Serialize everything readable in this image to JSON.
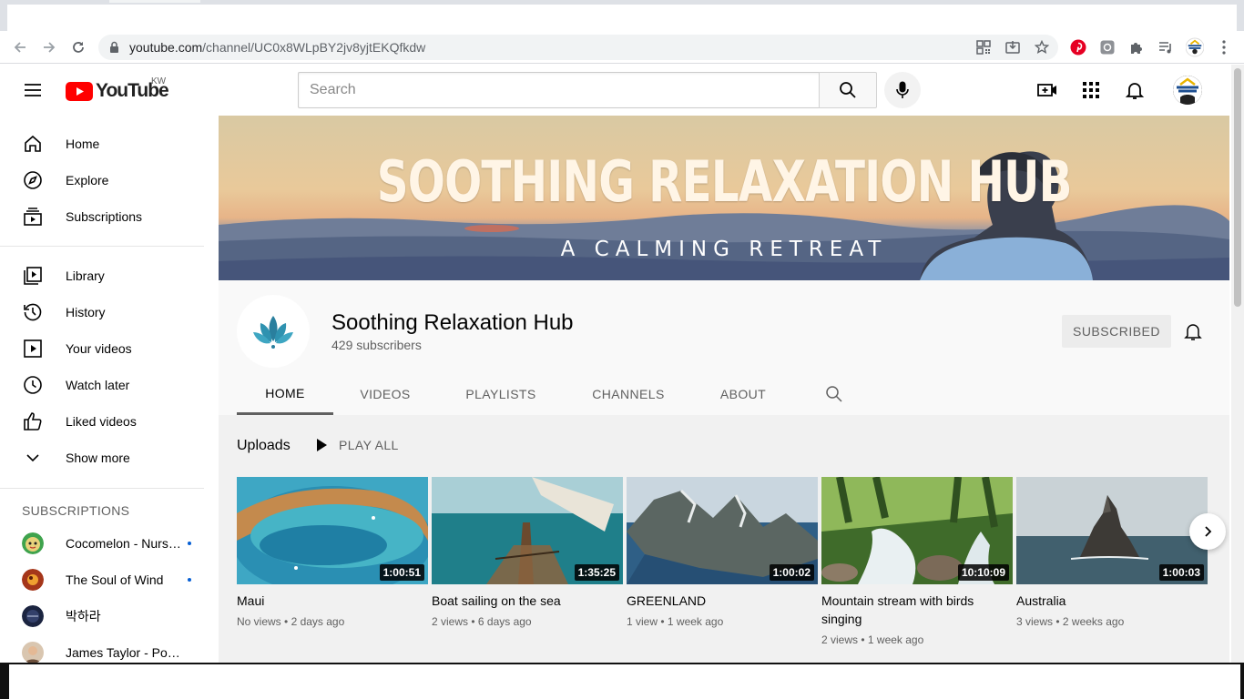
{
  "browser": {
    "url_host": "youtube.com",
    "url_path": "/channel/UC0x8WLpBY2jv8yjtEKQfkdw",
    "icons": [
      "back-icon",
      "forward-icon",
      "reload-icon",
      "lock-icon",
      "qr-code-icon",
      "install-icon",
      "star-icon",
      "pinterest-icon",
      "extension-icon",
      "puzzle-icon",
      "media-queue-icon",
      "profile-icon",
      "menu-icon"
    ]
  },
  "masthead": {
    "logo_text": "YouTube",
    "country_code": "KW",
    "search_placeholder": "Search",
    "brand_color": "#ff0000"
  },
  "sidebar": {
    "main_items": [
      {
        "label": "Home",
        "icon": "home-icon"
      },
      {
        "label": "Explore",
        "icon": "compass-icon"
      },
      {
        "label": "Subscriptions",
        "icon": "subscriptions-icon"
      }
    ],
    "library_items": [
      {
        "label": "Library",
        "icon": "library-icon"
      },
      {
        "label": "History",
        "icon": "history-icon"
      },
      {
        "label": "Your videos",
        "icon": "your-videos-icon"
      },
      {
        "label": "Watch later",
        "icon": "clock-icon"
      },
      {
        "label": "Liked videos",
        "icon": "thumb-up-icon"
      },
      {
        "label": "Show more",
        "icon": "chevron-down-icon"
      }
    ],
    "subscriptions_heading": "SUBSCRIPTIONS",
    "subscriptions": [
      {
        "name": "Cocomelon - Nursery Rhymes",
        "new": true
      },
      {
        "name": "The Soul of Wind",
        "new": true
      },
      {
        "name": "박하라",
        "new": false
      },
      {
        "name": "James Taylor - PowAfrica",
        "new": false
      }
    ]
  },
  "channel": {
    "banner_title": "SOOTHING RELAXATION HUB",
    "banner_subtitle": "A CALMING RETREAT",
    "name": "Soothing Relaxation Hub",
    "subscribers": "429 subscribers",
    "subscribe_label": "SUBSCRIBED",
    "tabs": [
      "HOME",
      "VIDEOS",
      "PLAYLISTS",
      "CHANNELS",
      "ABOUT"
    ],
    "active_tab": "HOME"
  },
  "uploads": {
    "title": "Uploads",
    "play_all": "PLAY ALL",
    "videos": [
      {
        "title": "Maui",
        "duration": "1:00:51",
        "views": "No views",
        "age": "2 days ago"
      },
      {
        "title": "Boat sailing on the sea",
        "duration": "1:35:25",
        "views": "2 views",
        "age": "6 days ago"
      },
      {
        "title": "GREENLAND",
        "duration": "1:00:02",
        "views": "1 view",
        "age": "1 week ago"
      },
      {
        "title": "Mountain stream with birds singing",
        "duration": "10:10:09",
        "views": "2 views",
        "age": "1 week ago"
      },
      {
        "title": "Australia",
        "duration": "1:00:03",
        "views": "3 views",
        "age": "2 weeks ago"
      }
    ]
  }
}
